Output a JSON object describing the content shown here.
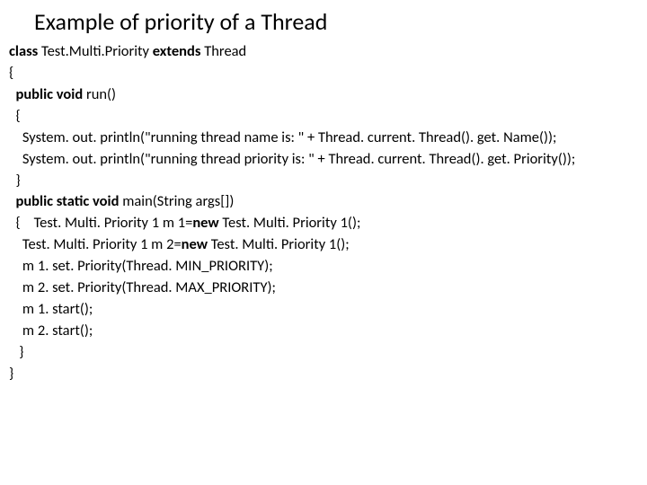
{
  "title": "Example of priority of a Thread",
  "lines": {
    "l1a": "class",
    "l1b": " Test.Multi.Priority ",
    "l1c": "extends",
    "l1d": " Thread",
    "l2": "{",
    "l3a": "  public",
    "l3b": " void",
    "l3c": " run()",
    "l4": "  {",
    "l5": "    System. out. println(\"running thread name is: \" + Thread. current. Thread(). get. Name());",
    "l6": "    System. out. println(\"running thread priority is: \" + Thread. current. Thread(). get. Priority());",
    "l7": "  }",
    "l8a": "  public",
    "l8b": " static",
    "l8c": " void",
    "l8d": " main(String args[])",
    "l9a": "  {    Test. Multi. Priority 1 m 1=",
    "l9b": "new",
    "l9c": " Test. Multi. Priority 1();",
    "l10a": "    Test. Multi. Priority 1 m 2=",
    "l10b": "new",
    "l10c": " Test. Multi. Priority 1();",
    "l11": "    m 1. set. Priority(Thread. MIN_PRIORITY);",
    "l12": "    m 2. set. Priority(Thread. MAX_PRIORITY);",
    "l13": "    m 1. start();",
    "l14": "    m 2. start();",
    "l15": "   }",
    "l16": "}"
  }
}
